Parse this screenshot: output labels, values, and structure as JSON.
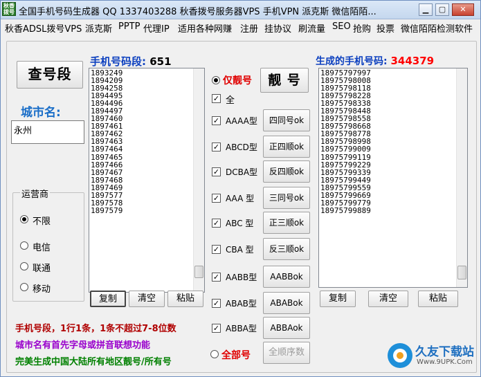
{
  "titlebar": {
    "icon_text": "秋香\n拨号",
    "title": "全国手机号码生成器 QQ 1337403288 秋香拨号服务器VPS 手机VPN 派克斯 微信陌陌...",
    "minimize": "▁",
    "maximize": "▢",
    "close": "✕"
  },
  "menu": [
    "秋香ADSL拨号VPS",
    "派克斯",
    "PPTP",
    "代理IP",
    "适用各种网赚",
    "注册",
    "挂协议",
    "刷流量",
    "SEO",
    "抢购",
    "投票",
    "微信陌陌检测软件"
  ],
  "left": {
    "query_button": "查号段",
    "city_label": "城市名:",
    "city_value": "永州",
    "carrier": {
      "title": "运营商",
      "options": [
        "不限",
        "电信",
        "联通",
        "移动"
      ],
      "selected": 0
    }
  },
  "segments": {
    "label": "手机号码段:",
    "count": "651",
    "items": [
      "1893249",
      "1894209",
      "1894258",
      "1894495",
      "1894496",
      "1894497",
      "1897460",
      "1897461",
      "1897462",
      "1897463",
      "1897464",
      "1897465",
      "1897466",
      "1897467",
      "1897468",
      "1897469",
      "1897577",
      "1897578",
      "1897579"
    ],
    "buttons": {
      "copy": "复制",
      "clear": "清空",
      "paste": "粘贴"
    }
  },
  "options": {
    "only_pretty": "仅靓号",
    "all_numbers": "全部号",
    "all_label": "全",
    "checkboxes": [
      "AAAA型",
      "ABCD型",
      "DCBA型",
      "AAA 型",
      "ABC 型",
      "CBA 型",
      "AABB型",
      "ABAB型",
      "ABBA型"
    ],
    "pretty_button": "靓 号",
    "type_buttons": [
      "四同号ok",
      "正四顺ok",
      "反四顺ok",
      "三同号ok",
      "正三顺ok",
      "反三顺ok",
      "AABBok",
      "ABABok",
      "ABBAok"
    ],
    "sequential_button": "全顺序数"
  },
  "generated": {
    "label": "生成的手机号码:",
    "count": "344379",
    "items": [
      "18975797997",
      "18975798008",
      "18975798118",
      "18975798228",
      "18975798338",
      "18975798448",
      "18975798558",
      "18975798668",
      "18975798778",
      "18975798998",
      "18975799009",
      "18975799119",
      "18975799229",
      "18975799339",
      "18975799449",
      "18975799559",
      "18975799669",
      "18975799779",
      "18975799889"
    ],
    "buttons": {
      "copy": "复制",
      "clear": "清空",
      "paste": "粘贴"
    }
  },
  "bottom_notes": [
    {
      "text": "手机号段，1行1条，1条不超过7-8位数",
      "color": "#b00000"
    },
    {
      "text": "城市名有首先字母或拼音联想功能",
      "color": "#9900cc"
    },
    {
      "text": "完美生成中国大陆所有地区靓号/所有号",
      "color": "#008000"
    }
  ],
  "watermark": {
    "brand": "久友下载站",
    "url": "Www.9UPK.Com"
  }
}
